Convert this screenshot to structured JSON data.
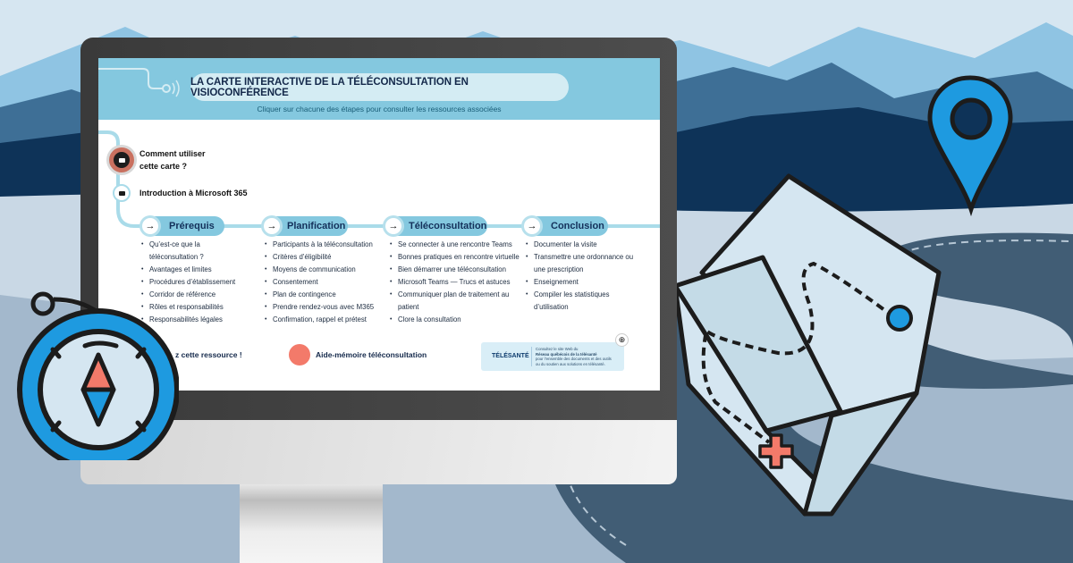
{
  "screen": {
    "title": "LA CARTE INTERACTIVE DE LA TÉLÉCONSULTATION EN VISIOCONFÉRENCE",
    "subtitle": "Cliquer sur chacune des étapes pour consulter les ressources associées",
    "intro": [
      {
        "label_line1": "Comment utiliser",
        "label_line2": "cette carte ?",
        "icon": "video-camera-icon",
        "active": true
      },
      {
        "label_line1": "Introduction à Microsoft 365",
        "icon": "video-camera-icon",
        "active": false
      }
    ],
    "steps": [
      {
        "label": "Prérequis",
        "icon": "arrow-right-icon",
        "items": [
          "Qu’est-ce que la",
          "téléconsultation ?",
          "Avantages et limites",
          "Procédures d’établissement",
          "Corridor de référence",
          "Rôles et responsabilités",
          "Responsabilités légales"
        ]
      },
      {
        "label": "Planification",
        "icon": "arrow-right-icon",
        "items": [
          "Participants à la téléconsultation",
          "Critères d’éligibilité",
          "Moyens de communication",
          "Consentement",
          "Plan de contingence",
          "Prendre rendez-vous avec M365",
          "Confirmation, rappel et prétest"
        ]
      },
      {
        "label": "Téléconsultation",
        "icon": "arrow-right-icon",
        "items": [
          "Se connecter à une rencontre Teams",
          "Bonnes pratiques en rencontre virtuelle",
          "Bien démarrer une téléconsultation",
          "Microsoft Teams — Trucs et astuces",
          "Communiquer plan de traitement au",
          "patient",
          "Clore la consultation"
        ]
      },
      {
        "label": "Conclusion",
        "icon": "arrow-right-icon",
        "items": [
          "Documenter la visite",
          "Transmettre une ordonnance ou",
          "une prescription",
          "Enseignement",
          "Compiler les statistiques",
          "d’utilisation"
        ]
      }
    ],
    "bottom": {
      "resource_text": "z cette ressource !",
      "aide_memoire": "Aide-mémoire téléconsultation",
      "telesante_logo": "TÉLÉSANTÉ",
      "telesante_line1": "Consultez le site Web du",
      "telesante_line2": "Réseau québécois de la télésanté",
      "telesante_line3": "pour l’ensemble des documents et des outils",
      "telesante_line4": "ou du soutien aux solutions en télésanté."
    }
  },
  "colors": {
    "accent_blue": "#84c8df",
    "title_navy": "#13284a",
    "coral": "#f37a6a",
    "pin_blue": "#1e9ae0",
    "mountain_dark": "#0e3358"
  }
}
